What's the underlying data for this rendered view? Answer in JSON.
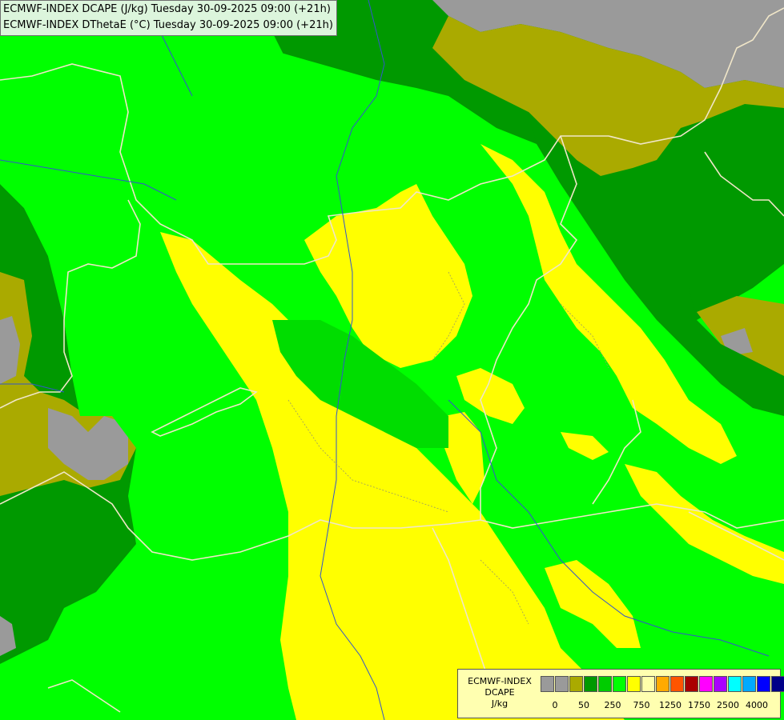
{
  "titles": [
    "ECMWF-INDEX DCAPE (J/kg) Tuesday 30-09-2025 09:00 (+21h)",
    "ECMWF-INDEX DThetaE (°C) Tuesday 30-09-2025 09:00 (+21h)"
  ],
  "legend": {
    "name_lines": [
      "ECMWF-INDEX",
      "DCAPE",
      "J/kg"
    ],
    "colors": [
      "#9a9a9a",
      "#9a9a9a",
      "#aaaa00",
      "#009900",
      "#00cc00",
      "#00ff00",
      "#ffff00",
      "#ffffaa",
      "#ffaa00",
      "#ff5500",
      "#aa0000",
      "#ff00ff",
      "#aa00ff",
      "#00ffff",
      "#00aaff",
      "#0000ff",
      "#000088"
    ],
    "tick_labels": [
      "0",
      "50",
      "250",
      "750",
      "1250",
      "1750",
      "2500",
      "4000"
    ]
  },
  "map_colors": {
    "gray": "#9a9a9a",
    "olive": "#aaaa00",
    "dark_green": "#009900",
    "green": "#00dd00",
    "lime": "#00ff00",
    "yellow": "#ffff00",
    "border": "#f0e6c8",
    "river": "#3355cc"
  }
}
